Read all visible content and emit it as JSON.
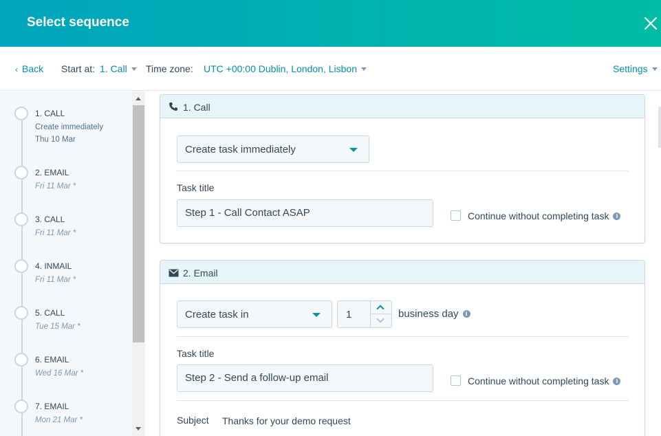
{
  "header": {
    "title": "Select sequence"
  },
  "toolbar": {
    "back_label": "Back",
    "start_at_label": "Start at:",
    "start_at_value": "1. Call",
    "timezone_label": "Time zone:",
    "timezone_value": "UTC +00:00 Dublin, London, Lisbon",
    "settings_label": "Settings"
  },
  "sidebar": {
    "steps": [
      {
        "title": "1. CALL",
        "line1": "Create immediately",
        "line2": "Thu 10 Mar"
      },
      {
        "title": "2. EMAIL",
        "date": "Fri 11 Mar *"
      },
      {
        "title": "3. CALL",
        "date": "Fri 11 Mar *"
      },
      {
        "title": "4. INMAIL",
        "date": "Fri 11 Mar *"
      },
      {
        "title": "5. CALL",
        "date": "Tue 15 Mar *"
      },
      {
        "title": "6. EMAIL",
        "date": "Wed 16 Mar *"
      },
      {
        "title": "7. EMAIL",
        "date": "Mon 21 Mar *"
      }
    ]
  },
  "cards": [
    {
      "title": "1. Call",
      "icon": "phone-icon",
      "task_select": "Create task immediately",
      "task_title_label": "Task title",
      "task_title_value": "Step 1 - Call Contact ASAP",
      "continue_label": "Continue without completing task"
    },
    {
      "title": "2. Email",
      "icon": "envelope-icon",
      "task_select": "Create task in",
      "delay_value": "1",
      "delay_unit": "business day",
      "task_title_label": "Task title",
      "task_title_value": "Step 2 - Send a follow-up email",
      "continue_label": "Continue without completing task",
      "subject_label": "Subject",
      "subject_value": "Thanks for your demo request"
    }
  ],
  "colors": {
    "accent": "#0091ae",
    "header_start": "#00a4bd",
    "header_end": "#00bda5"
  }
}
